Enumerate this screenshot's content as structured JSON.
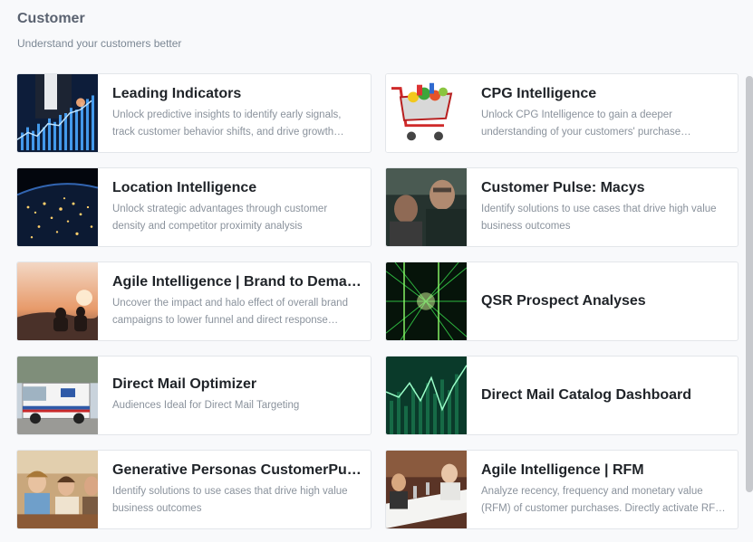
{
  "header": {
    "title": "Customer",
    "subtitle": "Understand your customers better"
  },
  "cards": [
    {
      "title": "Leading Indicators",
      "desc": "Unlock predictive insights to identify early signals, track customer behavior shifts, and drive growth…",
      "icon": "growth-chart-image"
    },
    {
      "title": "CPG Intelligence",
      "desc": "Unlock CPG Intelligence to gain a deeper understanding of your customers' purchase…",
      "icon": "shopping-cart-image"
    },
    {
      "title": "Location Intelligence",
      "desc": "Unlock strategic advantages through customer density and competitor proximity analysis",
      "icon": "earth-night-image"
    },
    {
      "title": "Customer Pulse: Macys",
      "desc": "Identify solutions to use cases that drive high value business outcomes",
      "icon": "people-talking-image"
    },
    {
      "title": "Agile Intelligence | Brand to Demand …",
      "desc": "Uncover the impact and halo effect of overall brand campaigns to lower funnel and direct response…",
      "icon": "sunset-silhouette-image"
    },
    {
      "title": "QSR Prospect Analyses",
      "desc": "",
      "icon": "green-data-lines-image"
    },
    {
      "title": "Direct Mail Optimizer",
      "desc": "Audiences Ideal for Direct Mail Targeting",
      "icon": "mail-truck-image"
    },
    {
      "title": "Direct Mail Catalog Dashboard",
      "desc": "",
      "icon": "green-stock-chart-image"
    },
    {
      "title": "Generative Personas CustomerPulse",
      "desc": "Identify solutions to use cases that drive high value business outcomes",
      "icon": "friends-cafe-image"
    },
    {
      "title": "Agile Intelligence | RFM",
      "desc": "Analyze recency, frequency and monetary value (RFM) of customer purchases. Directly activate RF…",
      "icon": "restaurant-table-image"
    }
  ]
}
